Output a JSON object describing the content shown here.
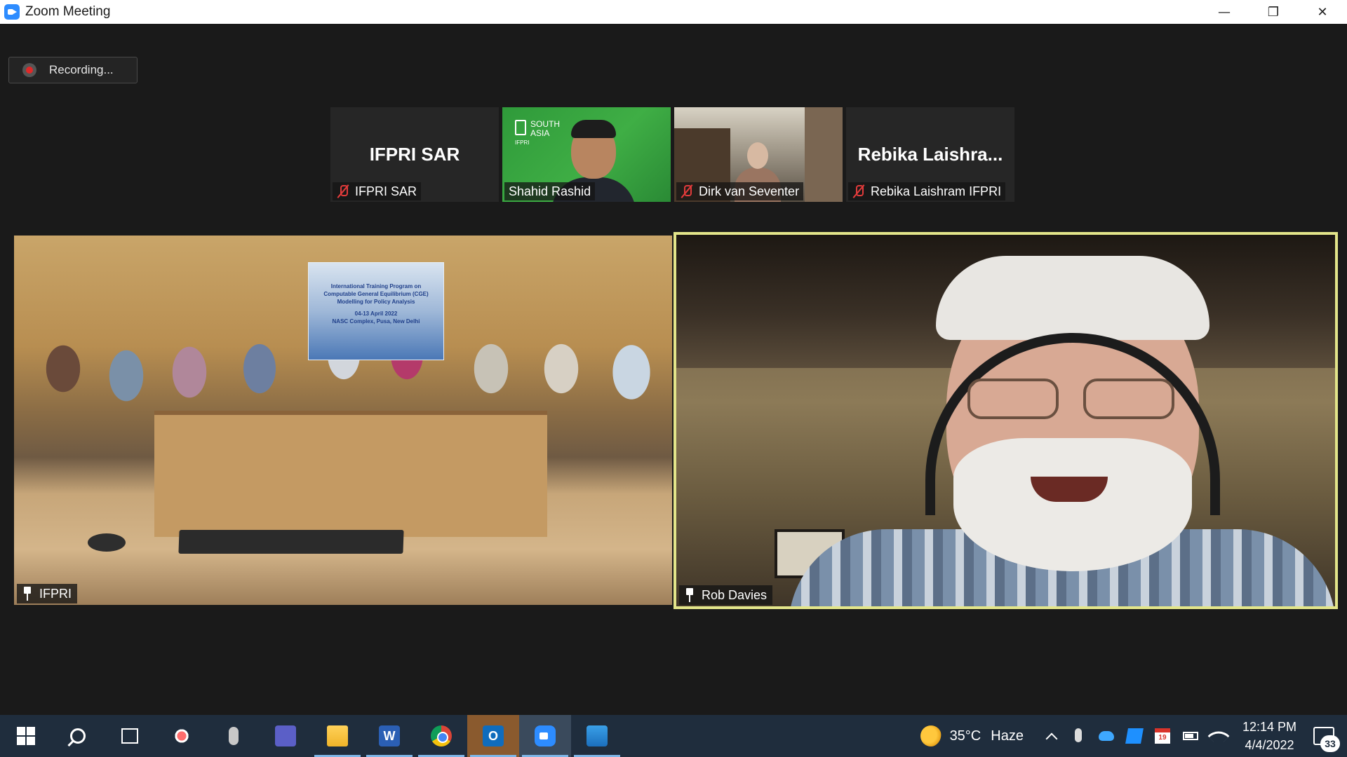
{
  "window": {
    "title": "Zoom Meeting",
    "controls": {
      "minimize": "—",
      "restore": "❐",
      "close": "✕"
    }
  },
  "recording": {
    "label": "Recording..."
  },
  "thumbnails": [
    {
      "big_name": "IFPRI SAR",
      "name": "IFPRI SAR",
      "muted": true
    },
    {
      "big_name": "",
      "name": "Shahid Rashid",
      "muted": false,
      "logo_text": [
        "SOUTH",
        "ASIA"
      ],
      "logo_sub": "IFPRI"
    },
    {
      "big_name": "",
      "name": "Dirk van Seventer",
      "muted": true
    },
    {
      "big_name": "Rebika  Laishra...",
      "name": "Rebika Laishram IFPRI",
      "muted": true
    }
  ],
  "main_tiles": [
    {
      "name": "IFPRI",
      "pinned": true,
      "banner": [
        "International Training Program on",
        "Computable General Equilibrium (CGE)",
        "Modelling for Policy Analysis",
        "04-13 April 2022",
        "NASC Complex, Pusa, New Delhi"
      ]
    },
    {
      "name": "Rob Davies",
      "pinned": true,
      "active_speaker": true
    }
  ],
  "taskbar": {
    "apps": [
      "windows-start",
      "search",
      "task-view",
      "snipping-tool",
      "voice-recorder",
      "teams",
      "file-explorer",
      "word",
      "chrome",
      "outlook",
      "zoom",
      "photos"
    ],
    "word_letter": "W",
    "outlook_letter": "O",
    "weather": {
      "temp": "35°C",
      "condition": "Haze"
    },
    "calendar_day": "19",
    "clock": {
      "time": "12:14 PM",
      "date": "4/4/2022"
    },
    "notifications": "33"
  },
  "colors": {
    "active_speaker_border": "#e3e58a",
    "muted_red": "#e23b3b",
    "taskbar_bg": "#1f2d3d"
  }
}
